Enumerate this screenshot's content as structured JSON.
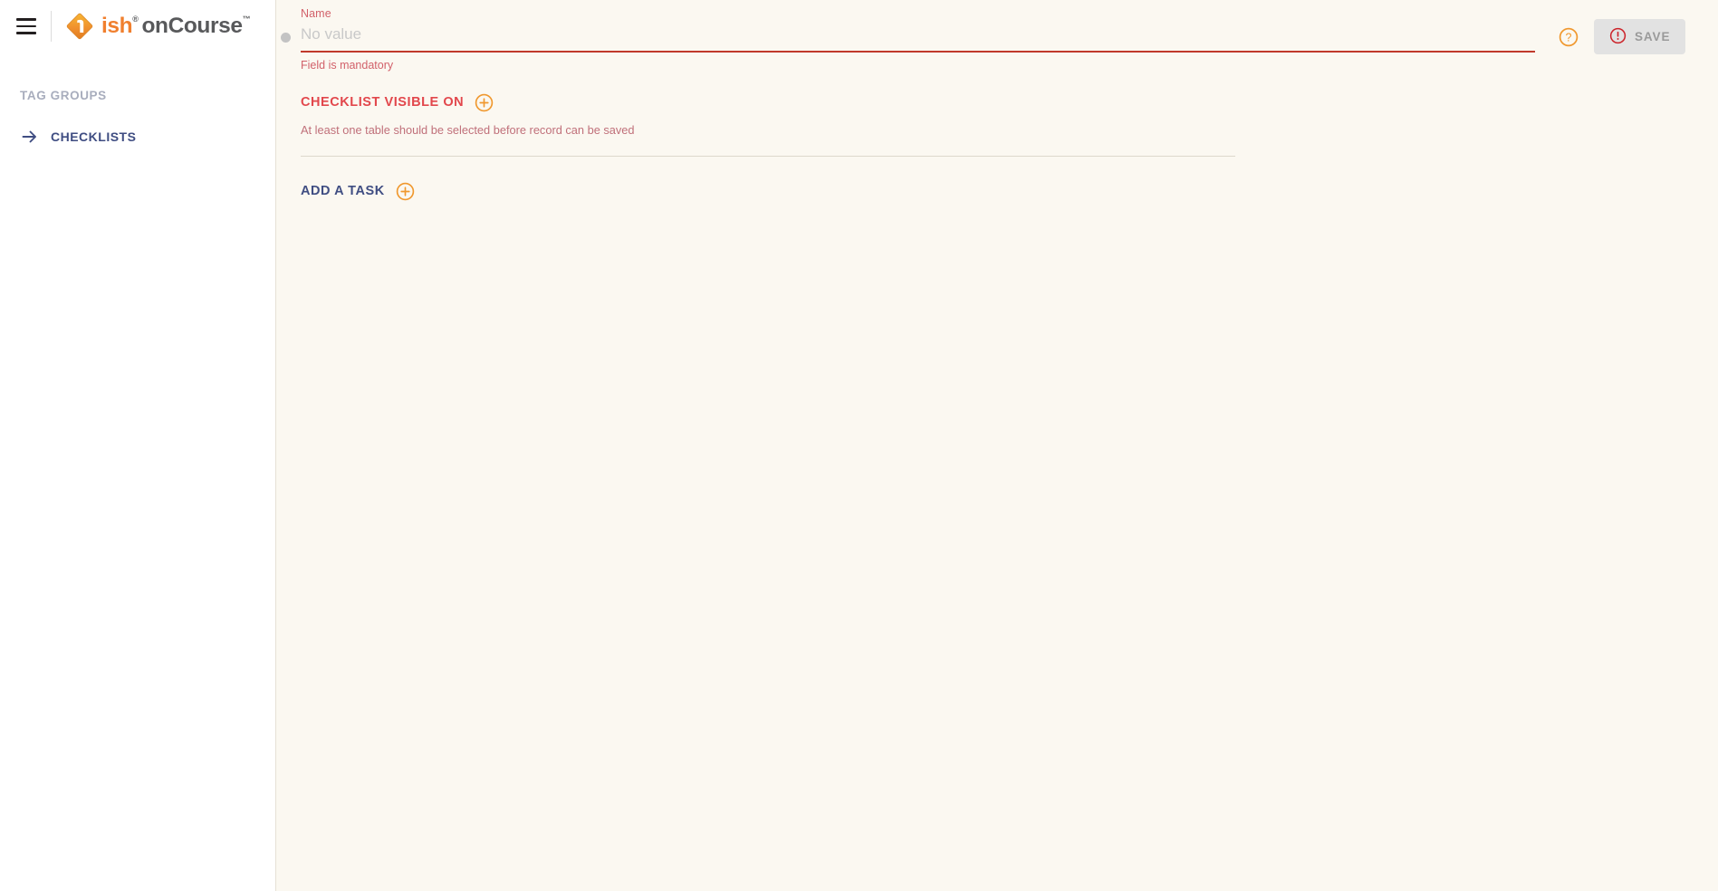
{
  "app": {
    "logo": {
      "mark_icon": "oncourse-diamond-logo-icon",
      "text_primary": "ish",
      "text_primary_sup": "®",
      "text_secondary": "onCourse",
      "text_secondary_sup": "™"
    },
    "menu_icon": "hamburger-menu-icon"
  },
  "sidebar": {
    "section_title": "TAG GROUPS",
    "items": [
      {
        "label": "CHECKLISTS",
        "icon": "arrow-right-icon"
      }
    ]
  },
  "main": {
    "name_field": {
      "label": "Name",
      "value": "",
      "placeholder": "No value",
      "helper_text": "Field is mandatory",
      "status_dot_icon": "status-dot-icon"
    },
    "help_icon": "help-question-icon",
    "save": {
      "label": "SAVE",
      "icon": "error-exclamation-icon",
      "disabled": true
    },
    "checklist_section": {
      "title": "CHECKLIST VISIBLE ON",
      "add_icon": "plus-circle-icon",
      "note": "At least one table should be selected before record can be saved"
    },
    "add_task": {
      "label": "ADD A TASK",
      "add_icon": "plus-circle-icon"
    }
  },
  "colors": {
    "accent_orange": "#f0982e",
    "brand_orange": "#f07f2e",
    "error_red": "#c0392b",
    "error_text": "#d2616a",
    "section_red": "#e2474c",
    "link_blue": "#3f4d82",
    "muted_gray": "#a8adbd",
    "canvas_cream": "#fbf8f1",
    "sidebar_white": "#ffffff"
  }
}
